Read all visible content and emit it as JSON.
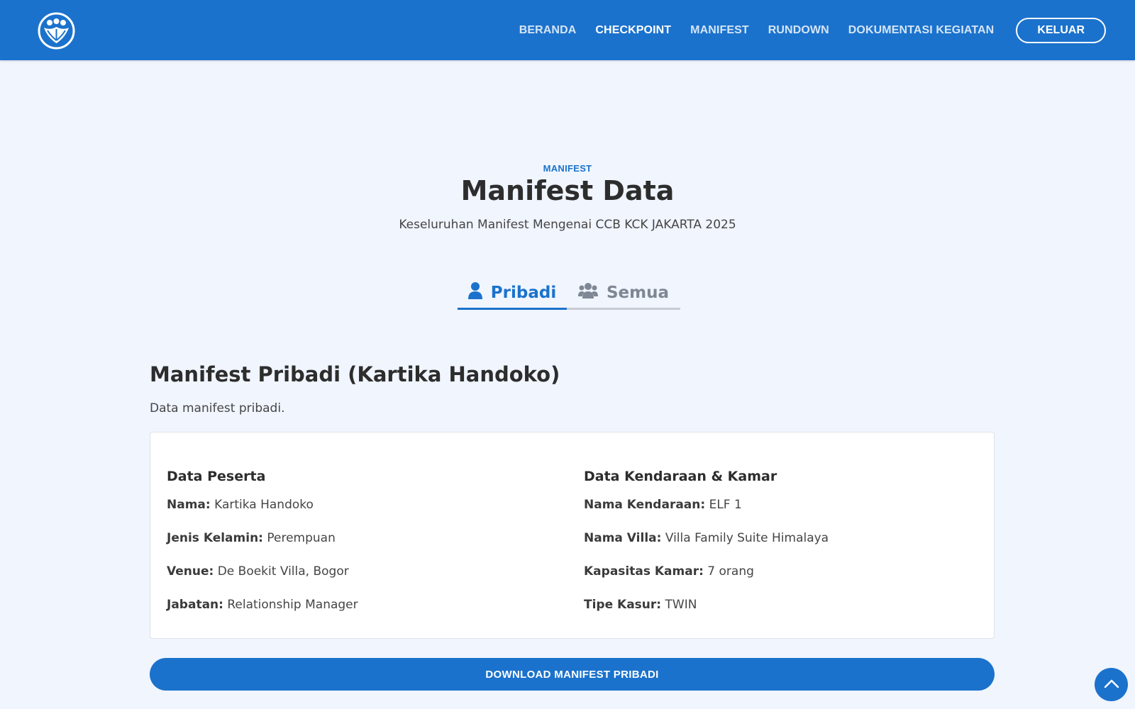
{
  "header": {
    "logo_icon": "people-circle-logo-icon",
    "nav": [
      {
        "label": "BERANDA",
        "active": false
      },
      {
        "label": "CHECKPOINT",
        "active": true
      },
      {
        "label": "MANIFEST",
        "active": false
      },
      {
        "label": "RUNDOWN",
        "active": false
      },
      {
        "label": "DOKUMENTASI KEGIATAN",
        "active": false
      }
    ],
    "logout_label": "KELUAR"
  },
  "section": {
    "eyebrow": "MANIFEST",
    "title": "Manifest Data",
    "subtitle": "Keseluruhan Manifest Mengenai CCB KCK JAKARTA 2025"
  },
  "tabs": [
    {
      "label": "Pribadi",
      "icon": "user-icon",
      "active": true
    },
    {
      "label": "Semua",
      "icon": "users-icon",
      "active": false
    }
  ],
  "personal": {
    "title": "Manifest Pribadi (Kartika Handoko)",
    "description": "Data manifest pribadi.",
    "left": {
      "title": "Data Peserta",
      "rows": [
        {
          "key": "Nama:",
          "value": "Kartika Handoko"
        },
        {
          "key": "Jenis Kelamin:",
          "value": "Perempuan"
        },
        {
          "key": "Venue:",
          "value": "De Boekit Villa, Bogor"
        },
        {
          "key": "Jabatan:",
          "value": "Relationship Manager"
        }
      ]
    },
    "right": {
      "title": "Data Kendaraan & Kamar",
      "rows": [
        {
          "key": "Nama Kendaraan:",
          "value": "ELF 1"
        },
        {
          "key": "Nama Villa:",
          "value": "Villa Family Suite Himalaya"
        },
        {
          "key": "Kapasitas Kamar:",
          "value": "7 orang"
        },
        {
          "key": "Tipe Kasur:",
          "value": "TWIN"
        }
      ]
    },
    "download_label": "DOWNLOAD MANIFEST PRIBADI"
  },
  "colors": {
    "primary": "#1b72cc",
    "background": "#f0f5fe",
    "card": "#ffffff"
  }
}
